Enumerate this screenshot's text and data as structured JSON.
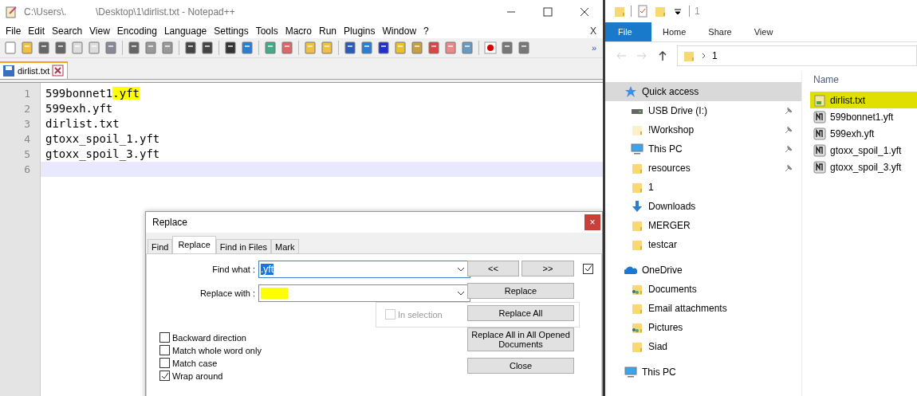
{
  "editor_window": {
    "title": "C:\\Users\\.           \\Desktop\\1\\dirlist.txt - Notepad++",
    "menu": [
      "File",
      "Edit",
      "Search",
      "View",
      "Encoding",
      "Language",
      "Settings",
      "Tools",
      "Macro",
      "Run",
      "Plugins",
      "Window",
      "?"
    ],
    "menu_close": "X",
    "toolbar_more": "»",
    "tabs": [
      {
        "label": "dirlist.txt",
        "selected": true
      }
    ],
    "lines": [
      {
        "number": "1",
        "current": false,
        "segments": [
          {
            "text": "599bonnet1",
            "highlight": false
          },
          {
            "text": ".yft",
            "highlight": true
          }
        ]
      },
      {
        "number": "2",
        "current": false,
        "segments": [
          {
            "text": "599exh.yft",
            "highlight": false
          }
        ]
      },
      {
        "number": "3",
        "current": false,
        "segments": [
          {
            "text": "dirlist.txt",
            "highlight": false
          }
        ]
      },
      {
        "number": "4",
        "current": false,
        "segments": [
          {
            "text": "gtoxx_spoil_1.yft",
            "highlight": false
          }
        ]
      },
      {
        "number": "5",
        "current": false,
        "segments": [
          {
            "text": "gtoxx_spoil_3.yft",
            "highlight": false
          }
        ]
      },
      {
        "number": "6",
        "current": true
      }
    ]
  },
  "replace_dialog": {
    "title": "Replace",
    "close": "×",
    "tabs": [
      {
        "label": "Find",
        "selected": false
      },
      {
        "label": "Replace",
        "selected": true
      },
      {
        "label": "Find in Files",
        "selected": false
      },
      {
        "label": "Mark",
        "selected": false
      }
    ],
    "find_what": {
      "label": "Find what :",
      "value": ".yft"
    },
    "replace_with": {
      "label": "Replace with :",
      "highlight": true
    },
    "buttons": {
      "prev": "<<",
      "next": ">>",
      "replace": "Replace",
      "replace_all": "Replace All",
      "replace_all_opened": "Replace All in All Opened Documents",
      "close": "Close"
    },
    "transparency_checked": true,
    "in_selection": {
      "label": "In selection",
      "checked": false,
      "disabled": true
    },
    "options": [
      {
        "label": "Backward direction",
        "checked": false
      },
      {
        "label": "Match whole word only",
        "checked": false
      },
      {
        "label": "Match case",
        "checked": false
      },
      {
        "label": "Wrap around",
        "checked": true
      }
    ]
  },
  "explorer_window": {
    "title": "1",
    "ribbon_tabs": [
      {
        "label": "File",
        "selected": true
      },
      {
        "label": "Home",
        "selected": false
      },
      {
        "label": "Share",
        "selected": false
      },
      {
        "label": "View",
        "selected": false
      }
    ],
    "address": "1",
    "nav": [
      {
        "label": "Quick access",
        "kind": "star",
        "selected": true,
        "children": [
          {
            "label": "USB Drive (I:)",
            "kind": "drive",
            "selected": false,
            "pinned": true
          },
          {
            "label": "!Workshop",
            "kind": "palefolder",
            "selected": false,
            "pinned": true
          },
          {
            "label": "This PC",
            "kind": "pc",
            "selected": false,
            "pinned": true
          },
          {
            "label": "resources",
            "kind": "folder",
            "selected": false,
            "pinned": true
          },
          {
            "label": "1",
            "kind": "folder",
            "selected": false,
            "pinned": false
          },
          {
            "label": "Downloads",
            "kind": "download",
            "selected": false,
            "pinned": false
          },
          {
            "label": "MERGER",
            "kind": "folder",
            "selected": false,
            "pinned": false
          },
          {
            "label": "testcar",
            "kind": "folder",
            "selected": false,
            "pinned": false
          }
        ]
      },
      {
        "label": "OneDrive",
        "kind": "cloud",
        "selected": false,
        "children": [
          {
            "label": "Documents",
            "kind": "shared",
            "selected": false,
            "pinned": false
          },
          {
            "label": "Email attachments",
            "kind": "folder",
            "selected": false,
            "pinned": false
          },
          {
            "label": "Pictures",
            "kind": "shared",
            "selected": false,
            "pinned": false
          },
          {
            "label": "Siad",
            "kind": "folder",
            "selected": false,
            "pinned": false
          }
        ]
      },
      {
        "label": "This PC",
        "kind": "pc",
        "selected": false
      }
    ],
    "column": "Name",
    "files": [
      {
        "name": "dirlist.txt",
        "kind": "notepad",
        "highlight": true
      },
      {
        "name": "599bonnet1.yft",
        "kind": "model",
        "highlight": false
      },
      {
        "name": "599exh.yft",
        "kind": "model",
        "highlight": false
      },
      {
        "name": "gtoxx_spoil_1.yft",
        "kind": "model",
        "highlight": false
      },
      {
        "name": "gtoxx_spoil_3.yft",
        "kind": "model",
        "highlight": false
      }
    ]
  }
}
